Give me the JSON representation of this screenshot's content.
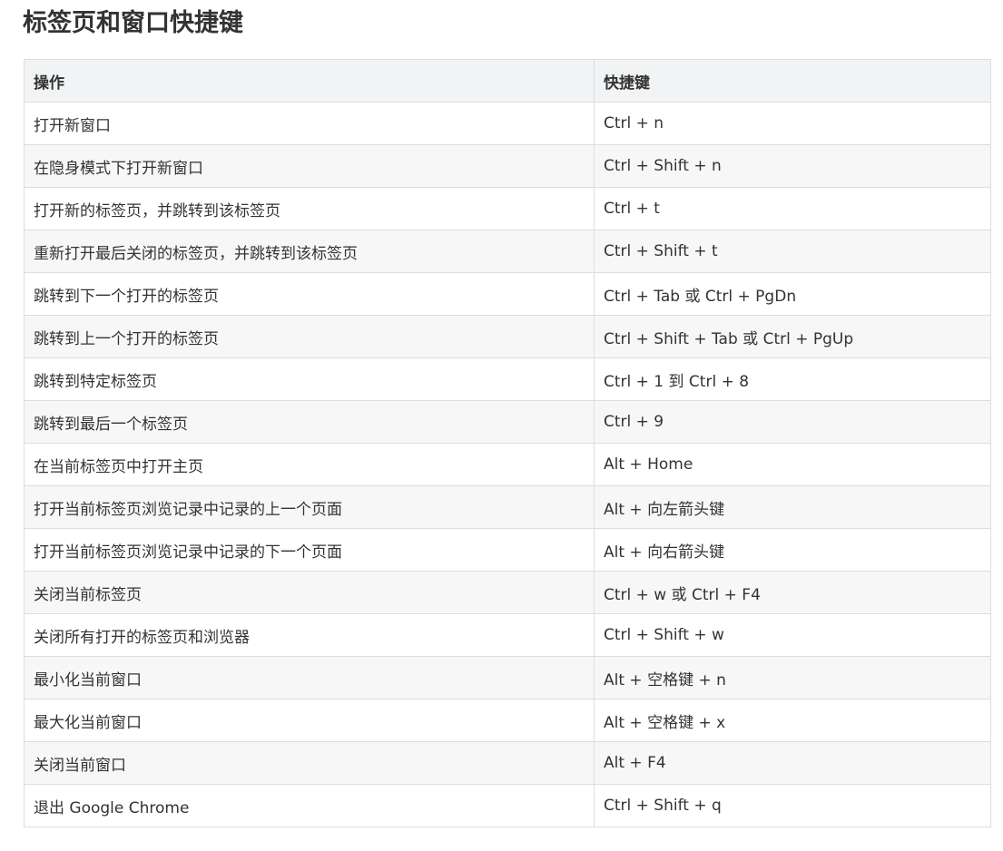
{
  "page_title": "标签页和窗口快捷键",
  "table": {
    "headers": [
      "操作",
      "快捷键"
    ],
    "rows": [
      [
        "打开新窗口",
        "Ctrl + n"
      ],
      [
        "在隐身模式下打开新窗口",
        "Ctrl + Shift + n"
      ],
      [
        "打开新的标签页，并跳转到该标签页",
        "Ctrl + t"
      ],
      [
        "重新打开最后关闭的标签页，并跳转到该标签页",
        "Ctrl + Shift + t"
      ],
      [
        "跳转到下一个打开的标签页",
        "Ctrl + Tab 或 Ctrl + PgDn"
      ],
      [
        "跳转到上一个打开的标签页",
        "Ctrl + Shift + Tab 或 Ctrl + PgUp"
      ],
      [
        "跳转到特定标签页",
        "Ctrl + 1 到 Ctrl + 8"
      ],
      [
        "跳转到最后一个标签页",
        "Ctrl + 9"
      ],
      [
        "在当前标签页中打开主页",
        "Alt + Home"
      ],
      [
        "打开当前标签页浏览记录中记录的上一个页面",
        "Alt + 向左箭头键"
      ],
      [
        "打开当前标签页浏览记录中记录的下一个页面",
        "Alt + 向右箭头键"
      ],
      [
        "关闭当前标签页",
        "Ctrl + w 或 Ctrl + F4"
      ],
      [
        "关闭所有打开的标签页和浏览器",
        "Ctrl + Shift + w"
      ],
      [
        "最小化当前窗口",
        "Alt + 空格键 + n"
      ],
      [
        "最大化当前窗口",
        "Alt + 空格键 + x"
      ],
      [
        "关闭当前窗口",
        "Alt + F4"
      ],
      [
        "退出 Google Chrome",
        "Ctrl + Shift + q"
      ]
    ]
  }
}
